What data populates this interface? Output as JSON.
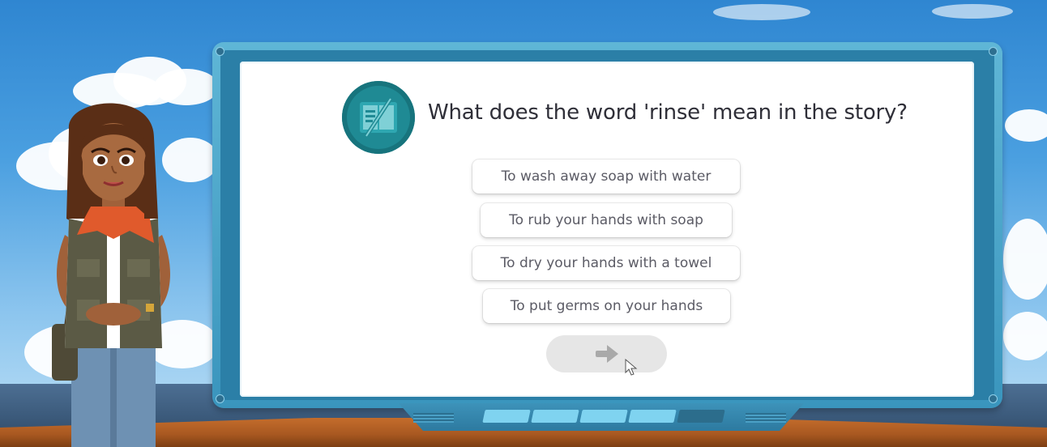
{
  "question": {
    "text": "What does the word 'rinse' mean in the story?",
    "icon": "vocabulary-book-icon"
  },
  "answers": [
    {
      "label": "To wash away soap with water"
    },
    {
      "label": "To rub your hands with soap"
    },
    {
      "label": "To dry your hands with a towel"
    },
    {
      "label": "To put germs on your hands"
    }
  ],
  "next_button": {
    "icon": "arrow-right-icon",
    "state": "disabled"
  },
  "progress": {
    "total_segments": 5,
    "completed_segments": 4
  },
  "colors": {
    "icon_teal": "#1f8a94",
    "frame_blue": "#3a95bd",
    "segment_active": "#7fd3f0",
    "segment_inactive": "#2c6d8c"
  }
}
